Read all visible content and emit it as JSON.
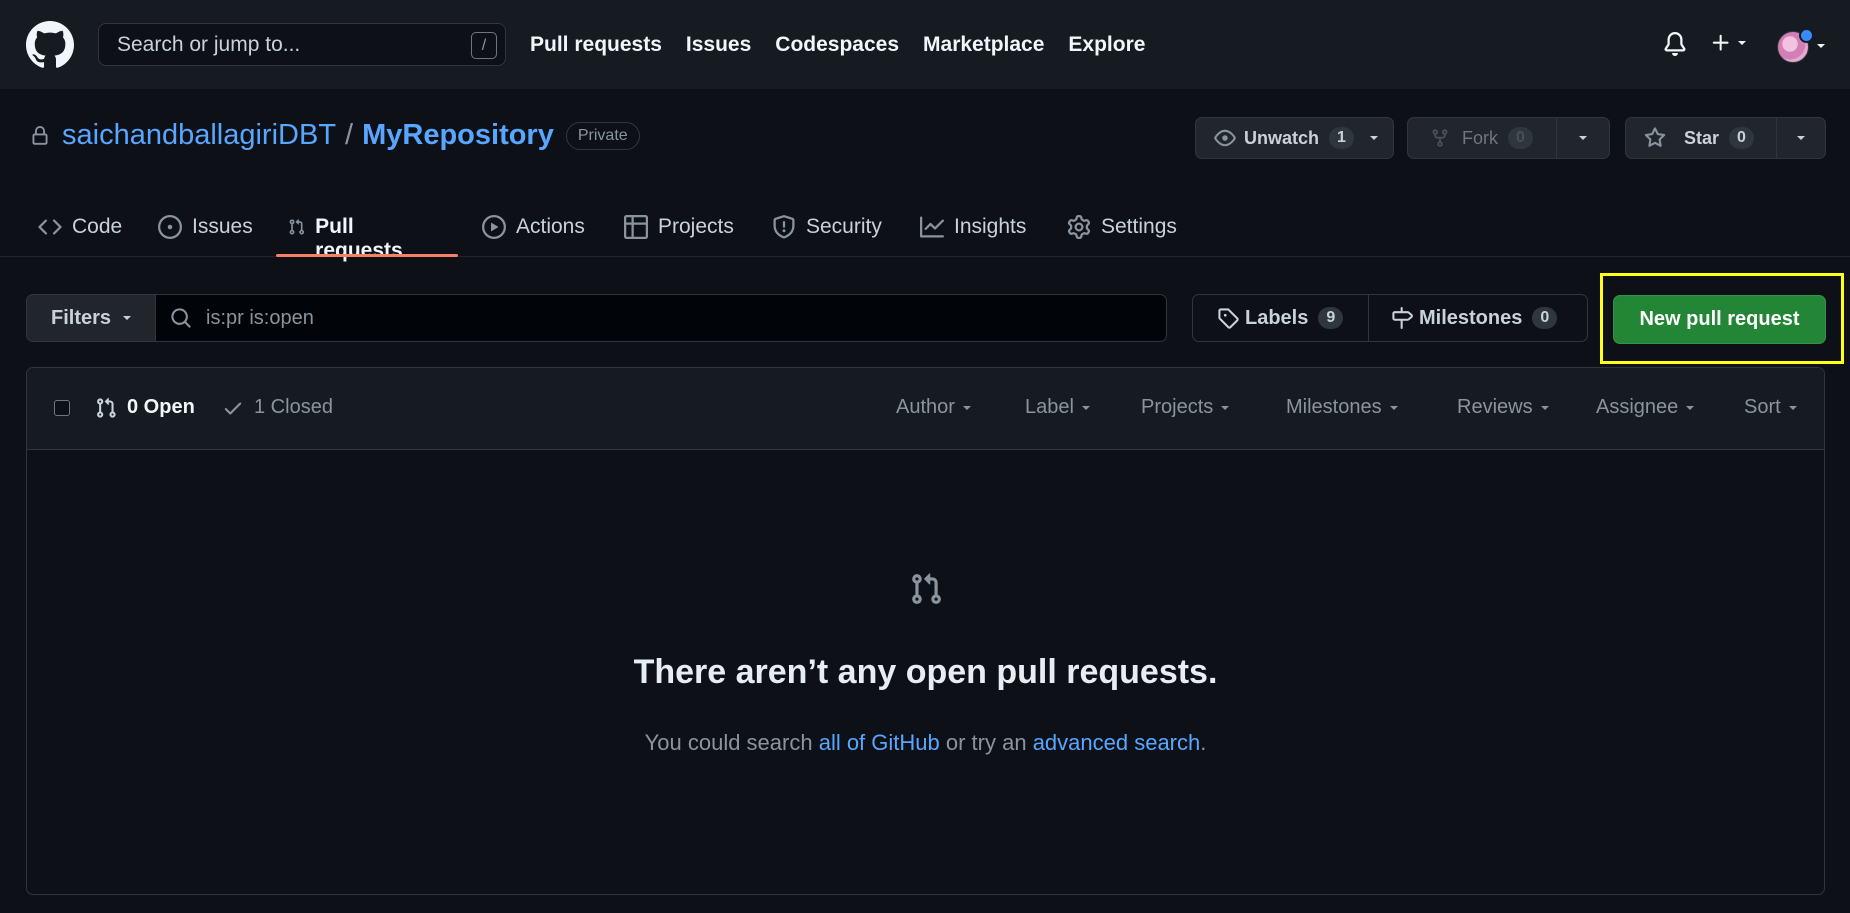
{
  "header": {
    "search_placeholder": "Search or jump to...",
    "search_shortcut": "/",
    "nav": [
      "Pull requests",
      "Issues",
      "Codespaces",
      "Marketplace",
      "Explore"
    ]
  },
  "repo": {
    "owner": "saichandballagiriDBT",
    "separator": "/",
    "name": "MyRepository",
    "visibility": "Private",
    "unwatch_label": "Unwatch",
    "watch_count": "1",
    "fork_label": "Fork",
    "fork_count": "0",
    "star_label": "Star",
    "star_count": "0"
  },
  "tabs": [
    {
      "label": "Code",
      "icon": "code-icon"
    },
    {
      "label": "Issues",
      "icon": "issue-opened-icon"
    },
    {
      "label": "Pull requests",
      "icon": "git-pull-request-icon",
      "active": true
    },
    {
      "label": "Actions",
      "icon": "play-icon"
    },
    {
      "label": "Projects",
      "icon": "table-icon"
    },
    {
      "label": "Security",
      "icon": "shield-icon"
    },
    {
      "label": "Insights",
      "icon": "graph-icon"
    },
    {
      "label": "Settings",
      "icon": "gear-icon"
    }
  ],
  "subnav": {
    "filters_label": "Filters",
    "filter_query": "is:pr is:open",
    "labels_label": "Labels",
    "labels_count": "9",
    "milestones_label": "Milestones",
    "milestones_count": "0",
    "new_pr_label": "New pull request"
  },
  "list": {
    "open_label": "0 Open",
    "closed_label": "1 Closed",
    "sort_menus": [
      "Author",
      "Label",
      "Projects",
      "Milestones",
      "Reviews",
      "Assignee",
      "Sort"
    ]
  },
  "blankslate": {
    "heading": "There aren’t any open pull requests.",
    "text_before": "You could search ",
    "link1": "all of GitHub",
    "text_middle": " or try an ",
    "link2": "advanced search",
    "text_after": "."
  },
  "colors": {
    "background": "#0d1117",
    "header_bg": "#161b22",
    "accent_link": "#58a6ff",
    "primary_button": "#238636",
    "active_tab_underline": "#f78166",
    "highlight_box": "#ffff1a"
  }
}
